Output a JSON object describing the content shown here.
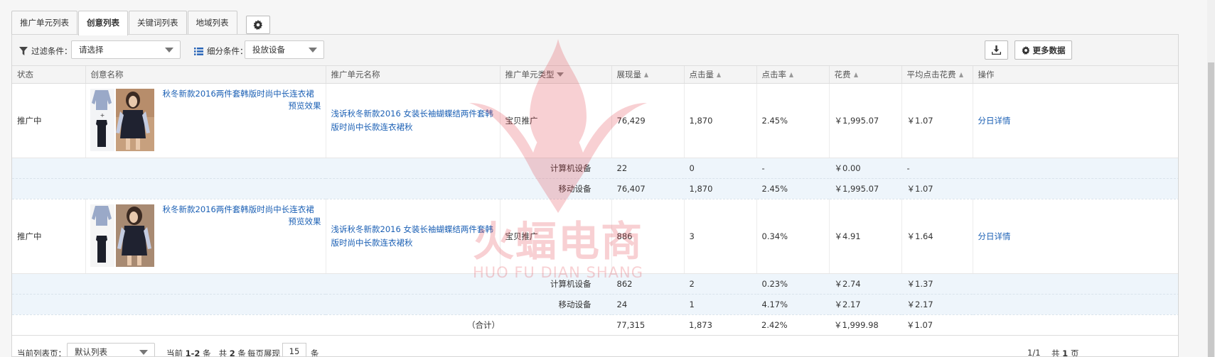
{
  "tabs": [
    {
      "label": "推广单元列表",
      "active": false
    },
    {
      "label": "创意列表",
      "active": true
    },
    {
      "label": "关键词列表",
      "active": false
    },
    {
      "label": "地域列表",
      "active": false
    }
  ],
  "toolbar": {
    "filter_label": "过滤条件：",
    "filter_value": "请选择",
    "segment_label": "细分条件：",
    "segment_value": "投放设备",
    "more_data_label": "更多数据"
  },
  "columns": [
    "状态",
    "创意名称",
    "推广单元名称",
    "推广单元类型",
    "展现量",
    "点击量",
    "点击率",
    "花费",
    "平均点击花费",
    "操作"
  ],
  "rows": [
    {
      "status": "推广中",
      "creative_title": "秋冬新款2016两件套韩版时尚中长连衣裙",
      "preview": "预览效果",
      "unit_name": "浅诉秋冬新款2016 女装长袖蝴蝶结两件套韩版时尚中长款连衣裙秋",
      "unit_type": "宝贝推广",
      "impressions": "76,429",
      "clicks": "1,870",
      "ctr": "2.45%",
      "cost": "￥1,995.07",
      "cpc": "￥1.07",
      "action": "分日详情",
      "devices": [
        {
          "name": "计算机设备",
          "impressions": "22",
          "clicks": "0",
          "ctr": "-",
          "cost": "￥0.00",
          "cpc": "-"
        },
        {
          "name": "移动设备",
          "impressions": "76,407",
          "clicks": "1,870",
          "ctr": "2.45%",
          "cost": "￥1,995.07",
          "cpc": "￥1.07"
        }
      ]
    },
    {
      "status": "推广中",
      "creative_title": "秋冬新款2016两件套韩版时尚中长连衣裙",
      "preview": "预览效果",
      "unit_name": "浅诉秋冬新款2016 女装长袖蝴蝶结两件套韩版时尚中长款连衣裙秋",
      "unit_type": "宝贝推广",
      "impressions": "886",
      "clicks": "3",
      "ctr": "0.34%",
      "cost": "￥4.91",
      "cpc": "￥1.64",
      "action": "分日详情",
      "devices": [
        {
          "name": "计算机设备",
          "impressions": "862",
          "clicks": "2",
          "ctr": "0.23%",
          "cost": "￥2.74",
          "cpc": "￥1.37"
        },
        {
          "name": "移动设备",
          "impressions": "24",
          "clicks": "1",
          "ctr": "4.17%",
          "cost": "￥2.17",
          "cpc": "￥2.17"
        }
      ]
    }
  ],
  "total": {
    "label": "（合计）",
    "impressions": "77,315",
    "clicks": "1,873",
    "ctr": "2.42%",
    "cost": "￥1,999.98",
    "cpc": "￥1.07"
  },
  "footer": {
    "current_list_label": "当前列表页：",
    "list_value": "默认列表",
    "current_prefix": "当前",
    "current_range": "1-2",
    "item_unit": "条",
    "total_prefix": "共",
    "total_count": "2",
    "per_page_label": "每页展现",
    "per_page": "15",
    "page_indicator": "1/1",
    "total_pages_prefix": "共",
    "total_pages": "1",
    "page_unit": "页"
  },
  "watermark": {
    "brand": "火蝠电商",
    "pinyin": "HUO FU DIAN SHANG"
  },
  "colors": {
    "link": "#1a5fb4",
    "sub_row_bg": "#eef5fb",
    "watermark": "#e0303a"
  }
}
